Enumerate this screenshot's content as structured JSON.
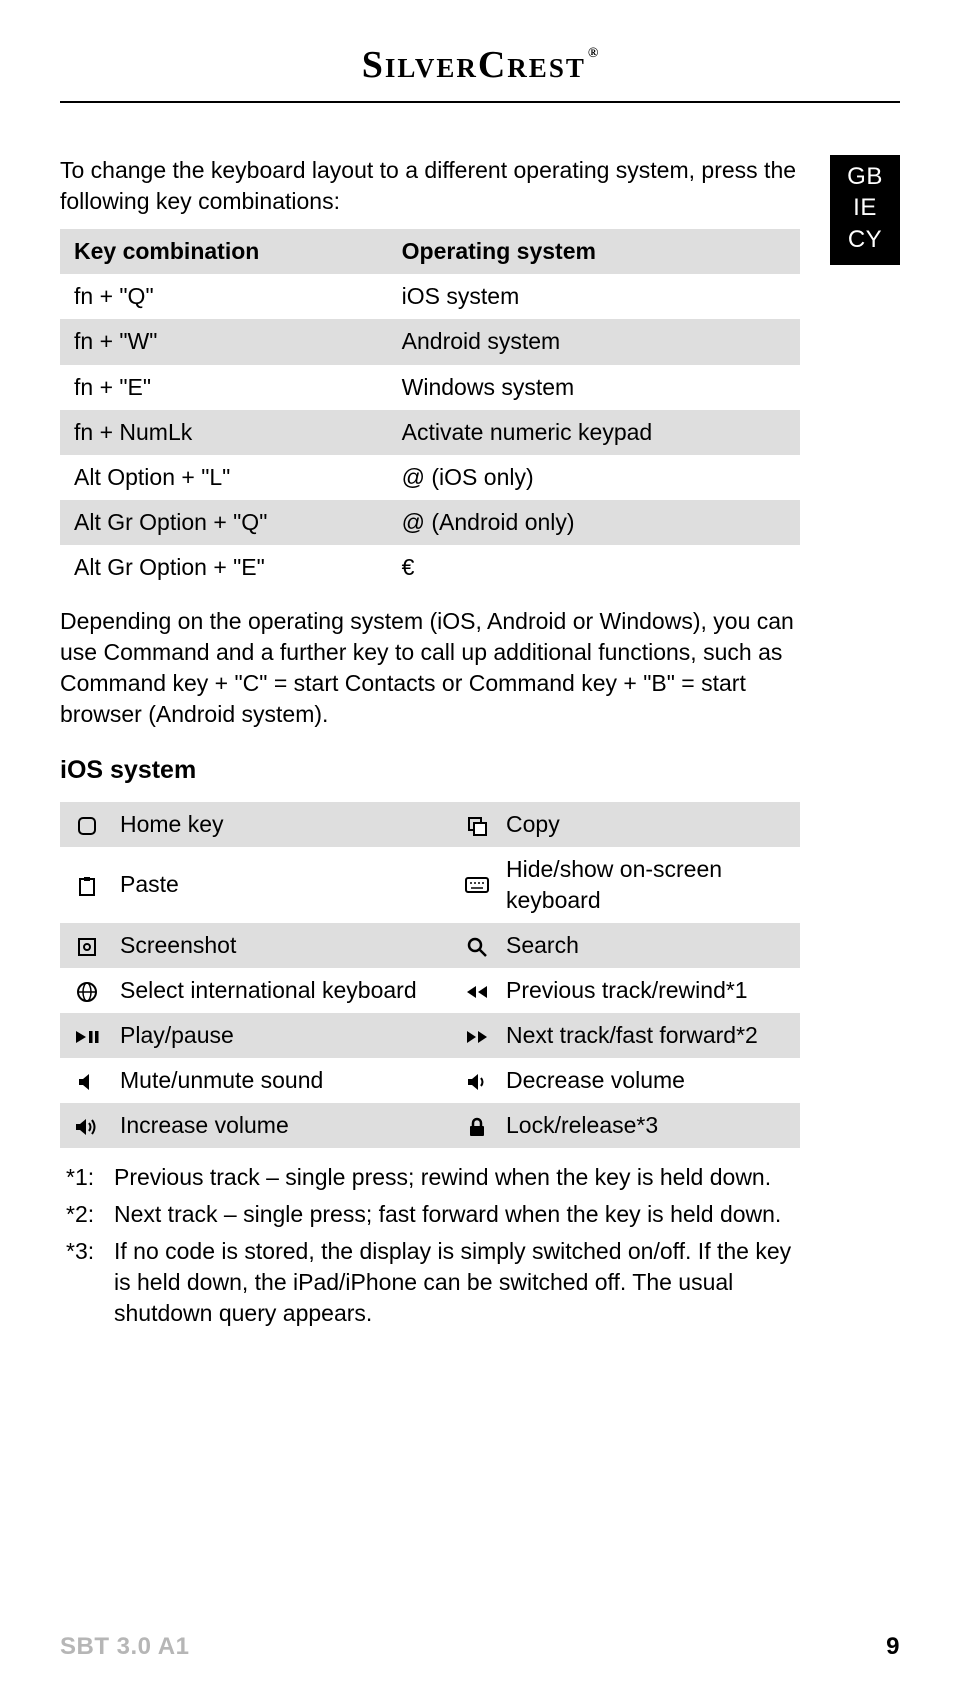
{
  "brand": "SilverCrest",
  "brand_reg": "®",
  "badge": {
    "l1": "GB",
    "l2": "IE",
    "l3": "CY"
  },
  "intro": "To change the keyboard layout to a different operating system, press the following key combinations:",
  "table1": {
    "h1": "Key combination",
    "h2": "Operating system",
    "rows": [
      {
        "k": "fn + \"Q\"",
        "v": "iOS system"
      },
      {
        "k": "fn + \"W\"",
        "v": "Android system"
      },
      {
        "k": "fn + \"E\"",
        "v": "Windows system"
      },
      {
        "k": "fn + NumLk",
        "v": "Activate numeric keypad"
      },
      {
        "k": "Alt Option + \"L\"",
        "v": "@ (iOS only)"
      },
      {
        "k": "Alt Gr Option + \"Q\"",
        "v": "@ (Android only)"
      },
      {
        "k": "Alt Gr Option + \"E\"",
        "v": "€"
      }
    ]
  },
  "para2": "Depending on the operating system (iOS, Android or Windows), you can use Command and a further key to call up additional functions, such as Command key + \"C\" = start Contacts or Command key + \"B\" = start browser (Android system).",
  "section2_title": "iOS system",
  "table2": {
    "items": [
      {
        "iconA": "home",
        "labelA": "Home key",
        "iconB": "copy",
        "labelB": "Copy"
      },
      {
        "iconA": "paste",
        "labelA": "Paste",
        "iconB": "keyboard",
        "labelB": "Hide/show on-screen keyboard"
      },
      {
        "iconA": "screenshot",
        "labelA": "Screenshot",
        "iconB": "search",
        "labelB": "Search"
      },
      {
        "iconA": "globe",
        "labelA": "Select international keyboard",
        "iconB": "prev",
        "labelB": "Previous track/rewind*1"
      },
      {
        "iconA": "playpause",
        "labelA": "Play/pause",
        "iconB": "next",
        "labelB": "Next track/fast forward*2"
      },
      {
        "iconA": "mute",
        "labelA": "Mute/unmute sound",
        "iconB": "voldown",
        "labelB": "Decrease volume"
      },
      {
        "iconA": "volup",
        "labelA": "Increase volume",
        "iconB": "lock",
        "labelB": "Lock/release*3"
      }
    ]
  },
  "notes": [
    {
      "k": "*1:",
      "t": "Previous track – single press; rewind when the key is held down."
    },
    {
      "k": "*2:",
      "t": "Next track – single press; fast forward when the key is held down."
    },
    {
      "k": "*3:",
      "t": "If no code is stored, the display is simply switched on/off. If the key is held down, the iPad/iPhone can be switched off. The usual shutdown query appears."
    }
  ],
  "footer": {
    "model": "SBT 3.0 A1",
    "page": "9"
  }
}
